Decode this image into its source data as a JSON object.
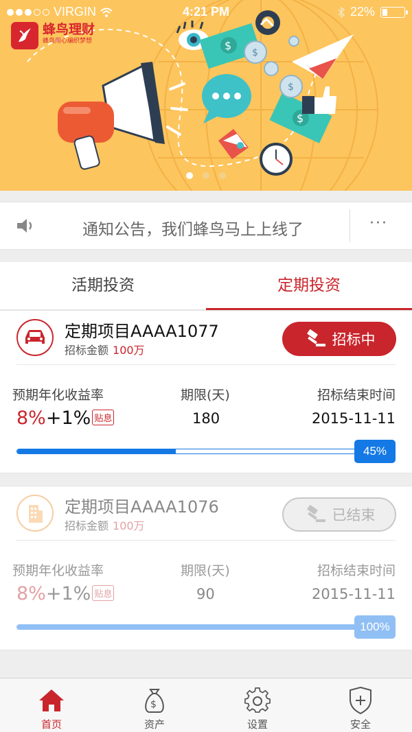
{
  "status_bar": {
    "carrier": "VIRGIN",
    "time": "4:21 PM",
    "battery_text": "22%",
    "battery_level": 0.22
  },
  "brand": {
    "name": "蜂鸟理财",
    "slogan": "蜂鸟用心编织梦想"
  },
  "banner": {
    "page_count": 3,
    "active_page": 1
  },
  "notice": {
    "text": "通知公告，我们蜂鸟马上上线了",
    "more": "···"
  },
  "tabs": [
    {
      "label": "活期投资",
      "active": false
    },
    {
      "label": "定期投资",
      "active": true
    }
  ],
  "projects": [
    {
      "name": "定期项目AAAA1077",
      "amount_label": "招标金额",
      "amount": "100万",
      "status": "招标中",
      "rate_label": "预期年化收益率",
      "rate_base": "8%",
      "rate_extra": "+1%",
      "rate_tag": "贴息",
      "term_label": "期限(天)",
      "term": "180",
      "end_label": "招标结束时间",
      "end_date": "2015-11-11",
      "progress": 0.45,
      "progress_text": "45%"
    },
    {
      "name": "定期项目AAAA1076",
      "amount_label": "招标金额",
      "amount": "100万",
      "status": "已结束",
      "rate_label": "预期年化收益率",
      "rate_base": "8%",
      "rate_extra": "+1%",
      "rate_tag": "贴息",
      "term_label": "期限(天)",
      "term": "90",
      "end_label": "招标结束时间",
      "end_date": "2015-11-11",
      "progress": 1.0,
      "progress_text": "100%"
    }
  ],
  "bottom_nav": [
    {
      "label": "首页",
      "icon": "home-icon",
      "active": true
    },
    {
      "label": "资产",
      "icon": "money-bag-icon",
      "active": false
    },
    {
      "label": "设置",
      "icon": "gear-icon",
      "active": false
    },
    {
      "label": "安全",
      "icon": "shield-icon",
      "active": false
    }
  ],
  "colors": {
    "brand_red": "#c9252c",
    "banner_bg": "#fdc55d",
    "progress_blue": "#1479e5"
  }
}
